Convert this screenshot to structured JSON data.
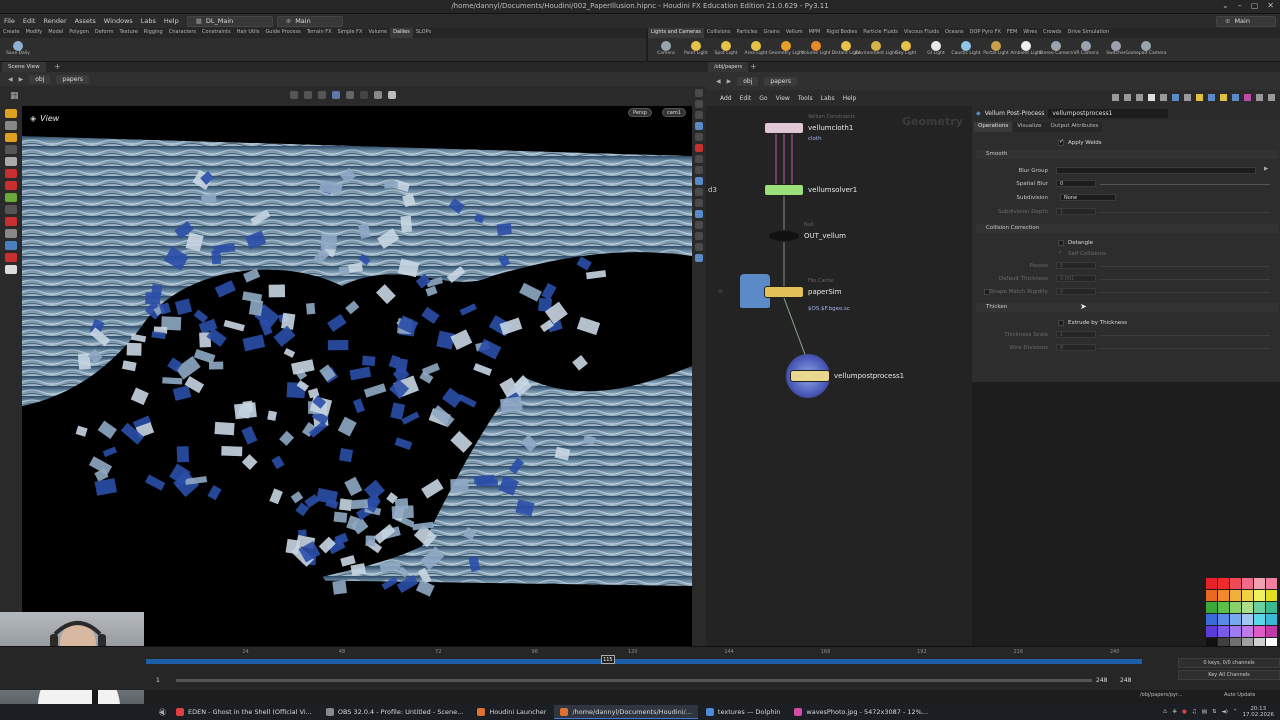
{
  "window": {
    "title": "/home/dannyl/Documents/Houdini/002_PaperIllusion.hipnc - Houdini FX Education Edition 21.0.629 - Py3.11",
    "controls": [
      "⌄",
      "–",
      "▢",
      "✕"
    ]
  },
  "menubar": {
    "items": [
      "File",
      "Edit",
      "Render",
      "Assets",
      "Windows",
      "Labs",
      "Help"
    ],
    "desktop_tab": "DL_Main",
    "desktop_tab2": "Main",
    "desktop_right": "Main"
  },
  "shelf_left": {
    "tabs": [
      "Create",
      "Modify",
      "Model",
      "Polygon",
      "Deform",
      "Texture",
      "Rigging",
      "Characters",
      "Constraints",
      "Hair Utils",
      "Guide Process",
      "Terrain FX",
      "Simple FX",
      "Volume",
      "Dailies",
      "SLOPs"
    ],
    "active_tab": "Dailies",
    "tools": [
      {
        "label": "Save Daily",
        "color": "#8fb0d0"
      }
    ]
  },
  "shelf_right": {
    "tabs": [
      "Lights and Cameras",
      "Collisions",
      "Particles",
      "Grains",
      "Vellum",
      "MPM",
      "Rigid Bodies",
      "Particle Fluids",
      "Viscous Fluids",
      "Oceans",
      "DOP Pyro FX",
      "FEM",
      "Wires",
      "Crowds",
      "Drive Simulation"
    ],
    "active_tab": "Lights and Cameras",
    "tools": [
      {
        "label": "Camera",
        "color": "#9aa3ad"
      },
      {
        "label": "Point Light",
        "color": "#e6c14a"
      },
      {
        "label": "Spot Light",
        "color": "#e6c14a"
      },
      {
        "label": "Area Light",
        "color": "#e6c14a"
      },
      {
        "label": "Geometry Light",
        "color": "#e6a02a"
      },
      {
        "label": "Volume Light",
        "color": "#e68a2a"
      },
      {
        "label": "Distant Light",
        "color": "#e6c14a"
      },
      {
        "label": "Environment Light",
        "color": "#d8b34a"
      },
      {
        "label": "Sky Light",
        "color": "#e6c14a"
      },
      {
        "label": "GI Light",
        "color": "#e8e8e8"
      },
      {
        "label": "Caustic Light",
        "color": "#8fc6e6"
      },
      {
        "label": "Portal Light",
        "color": "#c8a04a"
      },
      {
        "label": "Ambient Light",
        "color": "#f0f0f0"
      },
      {
        "label": "Stereo Camera",
        "color": "#9aa3ad"
      },
      {
        "label": "VR Camera",
        "color": "#9aa3ad"
      },
      {
        "label": "Switcher",
        "color": "#9aa3ad"
      },
      {
        "label": "Gamepad Camera",
        "color": "#9aa3ad"
      }
    ]
  },
  "scene_view": {
    "tab": "Scene View",
    "path": [
      "obj",
      "papers"
    ],
    "view_label": "View",
    "persp_btn": "Persp",
    "cam_btn": "cam1"
  },
  "network": {
    "tab": "/obj/papers",
    "path": [
      "obj",
      "papers"
    ],
    "menu": [
      "Add",
      "Edit",
      "Go",
      "View",
      "Tools",
      "Labs",
      "Help"
    ],
    "context_label": "Geometry",
    "side_label": "d3",
    "nodes": [
      {
        "name": "vellumcloth1",
        "type": "Vellum Constraints",
        "sub": "cloth",
        "color": "#e0c7d8"
      },
      {
        "name": "vellumsolver1",
        "type": "",
        "sub": "",
        "color": "#9be07a"
      },
      {
        "name": "OUT_vellum",
        "type": "Null",
        "sub": "",
        "color": "#111111"
      },
      {
        "name": "paperSim",
        "type": "File Cache",
        "sub": "$OS.$F.bgeo.sc",
        "color": "#e3c158"
      },
      {
        "name": "vellumpostprocess1",
        "type": "",
        "sub": "",
        "color": "#e8d890"
      }
    ]
  },
  "params": {
    "node_type": "Vellum Post-Process",
    "node_name": "vellumpostprocess1",
    "tabs": [
      "Operations",
      "Visualize",
      "Output Attributes"
    ],
    "active_tab": "Operations",
    "apply_welds": "Apply Welds",
    "sec_smooth": "Smooth",
    "blur_group": "Blur Group",
    "spatial_blur": "Spatial Blur",
    "spatial_blur_val": "0",
    "subdivision": "Subdivision",
    "subdivision_val": "None",
    "subdivision_depth": "Subdivision Depth",
    "subdivision_depth_val": "1",
    "sec_collision": "Collision Correction",
    "detangle": "Detangle",
    "self_collisions": "Self Collisions",
    "passes": "Passes",
    "passes_val": "5",
    "default_thickness": "Default Thickness",
    "default_thickness_val": "0.001",
    "shape_match": "Shape Match Rigidity",
    "shape_match_val": "0",
    "sec_thicken": "Thicken",
    "extrude": "Extrude by Thickness",
    "thickness_scale": "Thickness Scale",
    "thickness_scale_val": "1",
    "wire_divisions": "Wire Divisions",
    "wire_divisions_val": "8"
  },
  "timeline": {
    "ticks": [
      "24",
      "48",
      "72",
      "96",
      "120",
      "144",
      "168",
      "192",
      "216",
      "240"
    ],
    "current_frame": "115",
    "start": "1",
    "end_a": "248",
    "end_b": "248",
    "keys_info": "0 keys, 0/0 channels",
    "key_all": "Key All Channels",
    "path_field": "/obj/papers/pyr...",
    "auto_update": "Auto Update"
  },
  "palette": [
    "#e8202a",
    "#f02a2a",
    "#f04a5a",
    "#f06a8a",
    "#f0a0b0",
    "#f080a0",
    "#e86a20",
    "#f08a2a",
    "#f0b03a",
    "#f0d040",
    "#f0f060",
    "#e0e020",
    "#3aa83a",
    "#5ac04a",
    "#8ad06a",
    "#aae08a",
    "#6ad0a0",
    "#3ab890",
    "#3a6ad8",
    "#5a8ae8",
    "#7aa8f0",
    "#a0c8f0",
    "#5ad8e8",
    "#3ab8d8",
    "#5a3ad8",
    "#7a5ae8",
    "#a07af0",
    "#c07ae8",
    "#e05ac8",
    "#c03aa8",
    "#101010",
    "#404040",
    "#707070",
    "#a0a0a0",
    "#d0d0d0",
    "#ffffff"
  ],
  "taskbar": {
    "items": [
      {
        "label": "EDEN - Ghost in the Shell (Official Vi...",
        "color": "#e04040"
      },
      {
        "label": "OBS 32.0.4 - Profile: Untitled - Scene...",
        "color": "#888888"
      },
      {
        "label": "Houdini Launcher",
        "color": "#e07030"
      },
      {
        "label": "/home/dannyl/Documents/Houdini/...",
        "color": "#e07030"
      },
      {
        "label": "textures — Dolphin",
        "color": "#4a8ad8"
      },
      {
        "label": "wavesPhoto.jpg - 5472x3087 - 12%...",
        "color": "#d84aa8"
      }
    ],
    "active_index": 3,
    "clock": "20:13",
    "date": "17.02.2026"
  }
}
